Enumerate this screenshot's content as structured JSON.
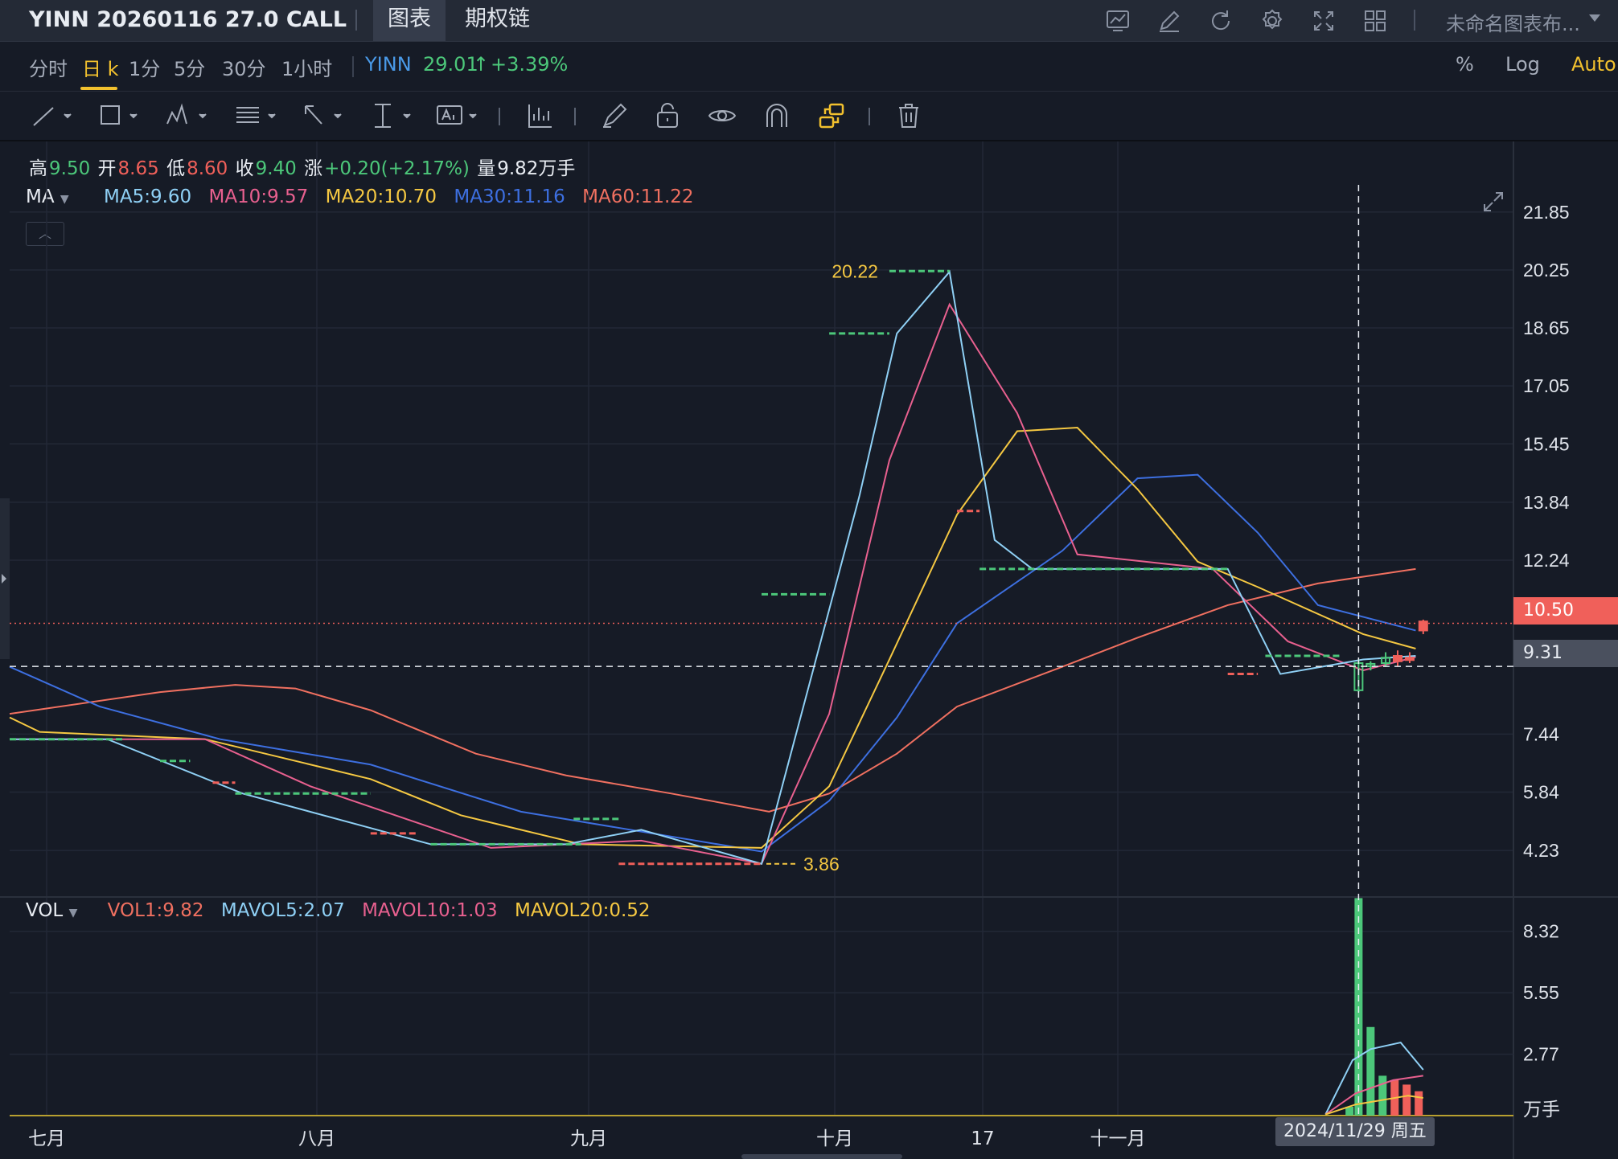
{
  "title_bar": {
    "symbol_title": "YINN 20260116 27.0 CALL",
    "tabs": [
      {
        "label": "图表",
        "active": true
      },
      {
        "label": "期权链",
        "active": false
      }
    ],
    "icons": [
      "chart-screenshot-icon",
      "edit-icon",
      "refresh-icon",
      "settings-icon",
      "fullscreen-icon",
      "grid-layout-icon"
    ],
    "layout_name": "未命名图表布..."
  },
  "periods": [
    {
      "label": "分时",
      "active": false
    },
    {
      "label": "日 k",
      "active": true
    },
    {
      "label": "1分",
      "active": false
    },
    {
      "label": "5分",
      "active": false
    },
    {
      "label": "30分",
      "active": false
    },
    {
      "label": "1小时",
      "active": false
    }
  ],
  "underlying": {
    "symbol": "YINN",
    "price": "29.01",
    "arrow": "↑",
    "change": "+3.39%"
  },
  "scale_options": [
    "%",
    "Log",
    "Auto"
  ],
  "drawing_tools": [
    "line-tool-icon",
    "rectangle-tool-icon",
    "pattern-tool-icon",
    "fib-tool-icon",
    "arrow-tool-icon",
    "measure-tool-icon",
    "text-tool-icon",
    "indicator-tool-icon",
    "brush-tool-icon",
    "lock-icon",
    "visibility-icon",
    "magnet-icon",
    "sync-icon",
    "trash-icon"
  ],
  "ohlc": {
    "high_label": "高",
    "high": "9.50",
    "open_label": "开",
    "open": "8.65",
    "low_label": "低",
    "low": "8.60",
    "close_label": "收",
    "close": "9.40",
    "change_label": "涨",
    "change": "+0.20(+2.17%)",
    "volume_label": "量",
    "volume": "9.82万手"
  },
  "ma_indicator": {
    "label": "MA",
    "values": [
      {
        "text": "MA5:9.60",
        "color": "#8fd0f5"
      },
      {
        "text": "MA10:9.57",
        "color": "#e8608f"
      },
      {
        "text": "MA20:10.70",
        "color": "#f5c842"
      },
      {
        "text": "MA30:11.16",
        "color": "#3d6fe0"
      },
      {
        "text": "MA60:11.22",
        "color": "#f07060"
      }
    ]
  },
  "vol_indicator": {
    "label": "VOL",
    "values": [
      {
        "text": "VOL1:9.82",
        "color": "#f07060"
      },
      {
        "text": "MAVOL5:2.07",
        "color": "#8fd0f5"
      },
      {
        "text": "MAVOL10:1.03",
        "color": "#e8608f"
      },
      {
        "text": "MAVOL20:0.52",
        "color": "#f5c842"
      }
    ]
  },
  "price_axis": [
    "21.85",
    "20.25",
    "18.65",
    "17.05",
    "15.45",
    "13.84",
    "12.24",
    "7.44",
    "5.84",
    "4.23"
  ],
  "volume_axis": [
    "8.32",
    "5.55",
    "2.77"
  ],
  "volume_unit": "万手",
  "x_axis": [
    "七月",
    "八月",
    "九月",
    "十月",
    "17",
    "十一月"
  ],
  "last_price_tag": "10.50",
  "crosshair_price_tag": "9.31",
  "crosshair_date_tag": "2024/11/29 周五",
  "annotations": {
    "high_marker": "20.22",
    "low_marker": "3.86"
  },
  "colors": {
    "up": "#4cc77a",
    "down": "#f0605a",
    "accent": "#f2c12e",
    "background": "#161b26"
  },
  "chart_data": {
    "type": "line",
    "title": "",
    "y_range": [
      3.3,
      22.6
    ],
    "ma5": [
      [
        0,
        7.3
      ],
      [
        0.065,
        7.3
      ],
      [
        0.155,
        5.8
      ],
      [
        0.28,
        4.4
      ],
      [
        0.37,
        4.4
      ],
      [
        0.42,
        4.8
      ],
      [
        0.5,
        3.86
      ],
      [
        0.565,
        14.0
      ],
      [
        0.59,
        18.5
      ],
      [
        0.625,
        20.2
      ],
      [
        0.655,
        12.8
      ],
      [
        0.68,
        12.0
      ],
      [
        0.81,
        12.0
      ],
      [
        0.845,
        9.1
      ],
      [
        0.9,
        9.5
      ],
      [
        0.935,
        9.6
      ]
    ],
    "ma10": [
      [
        0,
        7.3
      ],
      [
        0.13,
        7.3
      ],
      [
        0.2,
        6.0
      ],
      [
        0.32,
        4.3
      ],
      [
        0.42,
        4.5
      ],
      [
        0.5,
        3.86
      ],
      [
        0.545,
        8.0
      ],
      [
        0.585,
        15.0
      ],
      [
        0.625,
        19.3
      ],
      [
        0.67,
        16.3
      ],
      [
        0.71,
        12.4
      ],
      [
        0.8,
        12.0
      ],
      [
        0.85,
        10.0
      ],
      [
        0.9,
        9.2
      ],
      [
        0.935,
        9.57
      ]
    ],
    "ma20": [
      [
        0,
        7.9
      ],
      [
        0.02,
        7.5
      ],
      [
        0.13,
        7.3
      ],
      [
        0.24,
        6.2
      ],
      [
        0.3,
        5.2
      ],
      [
        0.38,
        4.4
      ],
      [
        0.5,
        4.3
      ],
      [
        0.545,
        6.0
      ],
      [
        0.585,
        9.5
      ],
      [
        0.63,
        13.5
      ],
      [
        0.67,
        15.8
      ],
      [
        0.71,
        15.9
      ],
      [
        0.75,
        14.2
      ],
      [
        0.79,
        12.2
      ],
      [
        0.83,
        11.5
      ],
      [
        0.9,
        10.2
      ],
      [
        0.935,
        9.8
      ]
    ],
    "ma30": [
      [
        0,
        9.3
      ],
      [
        0.06,
        8.2
      ],
      [
        0.14,
        7.3
      ],
      [
        0.24,
        6.6
      ],
      [
        0.34,
        5.3
      ],
      [
        0.5,
        4.2
      ],
      [
        0.545,
        5.6
      ],
      [
        0.59,
        7.9
      ],
      [
        0.63,
        10.5
      ],
      [
        0.7,
        12.5
      ],
      [
        0.75,
        14.5
      ],
      [
        0.79,
        14.6
      ],
      [
        0.83,
        13.0
      ],
      [
        0.87,
        11.0
      ],
      [
        0.935,
        10.3
      ]
    ],
    "ma60": [
      [
        0,
        8.0
      ],
      [
        0.1,
        8.6
      ],
      [
        0.15,
        8.8
      ],
      [
        0.19,
        8.7
      ],
      [
        0.24,
        8.1
      ],
      [
        0.31,
        6.9
      ],
      [
        0.37,
        6.3
      ],
      [
        0.44,
        5.8
      ],
      [
        0.505,
        5.3
      ],
      [
        0.545,
        5.8
      ],
      [
        0.59,
        6.9
      ],
      [
        0.63,
        8.2
      ],
      [
        0.7,
        9.3
      ],
      [
        0.75,
        10.1
      ],
      [
        0.81,
        11.0
      ],
      [
        0.87,
        11.6
      ],
      [
        0.935,
        12.0
      ]
    ],
    "candles": [
      {
        "x": 0.897,
        "open": 8.65,
        "high": 9.5,
        "low": 8.6,
        "close": 9.4
      },
      {
        "x": 0.905,
        "open": 9.35,
        "high": 9.45,
        "low": 9.2,
        "close": 9.38
      },
      {
        "x": 0.915,
        "open": 9.4,
        "high": 9.7,
        "low": 9.3,
        "close": 9.55
      },
      {
        "x": 0.923,
        "open": 9.6,
        "high": 9.75,
        "low": 9.3,
        "close": 9.45
      },
      {
        "x": 0.931,
        "open": 9.55,
        "high": 9.7,
        "low": 9.4,
        "close": 9.5
      },
      {
        "x": 0.94,
        "open": 10.55,
        "high": 10.6,
        "low": 10.2,
        "close": 10.3
      }
    ],
    "volume": {
      "y_range": [
        0,
        9.0
      ],
      "bars": [
        {
          "x": 0.891,
          "value": 0.4,
          "up": true
        },
        {
          "x": 0.897,
          "value": 9.82,
          "up": true
        },
        {
          "x": 0.905,
          "value": 4.0,
          "up": true
        },
        {
          "x": 0.913,
          "value": 1.8,
          "up": true
        },
        {
          "x": 0.921,
          "value": 1.6,
          "up": false
        },
        {
          "x": 0.929,
          "value": 1.4,
          "up": false
        },
        {
          "x": 0.937,
          "value": 1.1,
          "up": false
        }
      ],
      "mavol5": [
        [
          0.875,
          0.05
        ],
        [
          0.893,
          2.5
        ],
        [
          0.905,
          3.0
        ],
        [
          0.925,
          3.3
        ],
        [
          0.94,
          2.07
        ]
      ],
      "mavol10": [
        [
          0.875,
          0.05
        ],
        [
          0.895,
          1.0
        ],
        [
          0.92,
          1.6
        ],
        [
          0.94,
          1.8
        ]
      ],
      "mavol20": [
        [
          0.875,
          0.05
        ],
        [
          0.895,
          0.5
        ],
        [
          0.93,
          0.9
        ],
        [
          0.94,
          0.8
        ]
      ]
    }
  }
}
